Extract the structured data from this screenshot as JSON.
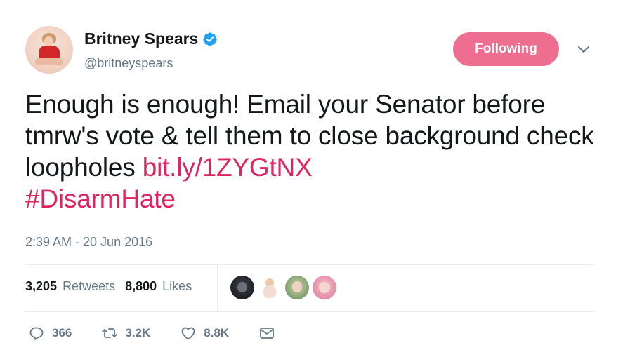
{
  "user": {
    "name": "Britney Spears",
    "handle": "@britneyspears",
    "verified": true
  },
  "follow_button": {
    "label": "Following",
    "color": "#ee6e8f"
  },
  "tweet": {
    "text": "Enough is enough! Email your Senator before tmrw's vote & tell them to close background check loopholes ",
    "link": "bit.ly/1ZYGtNX",
    "hashtag": "#DisarmHate",
    "timestamp": "2:39 AM - 20 Jun 2016",
    "link_color": "#e0245e"
  },
  "stats": {
    "retweets_count": "3,205",
    "retweets_label": "Retweets",
    "likes_count": "8,800",
    "likes_label": "Likes"
  },
  "likers": [
    "avatar-1",
    "avatar-2",
    "avatar-3",
    "avatar-4"
  ],
  "actions": {
    "replies": "366",
    "retweets": "3.2K",
    "likes": "8.8K"
  },
  "icons": {
    "verified": "verified-badge-icon",
    "caret": "chevron-down-icon",
    "reply": "reply-icon",
    "retweet": "retweet-icon",
    "like": "heart-icon",
    "dm": "envelope-icon"
  }
}
